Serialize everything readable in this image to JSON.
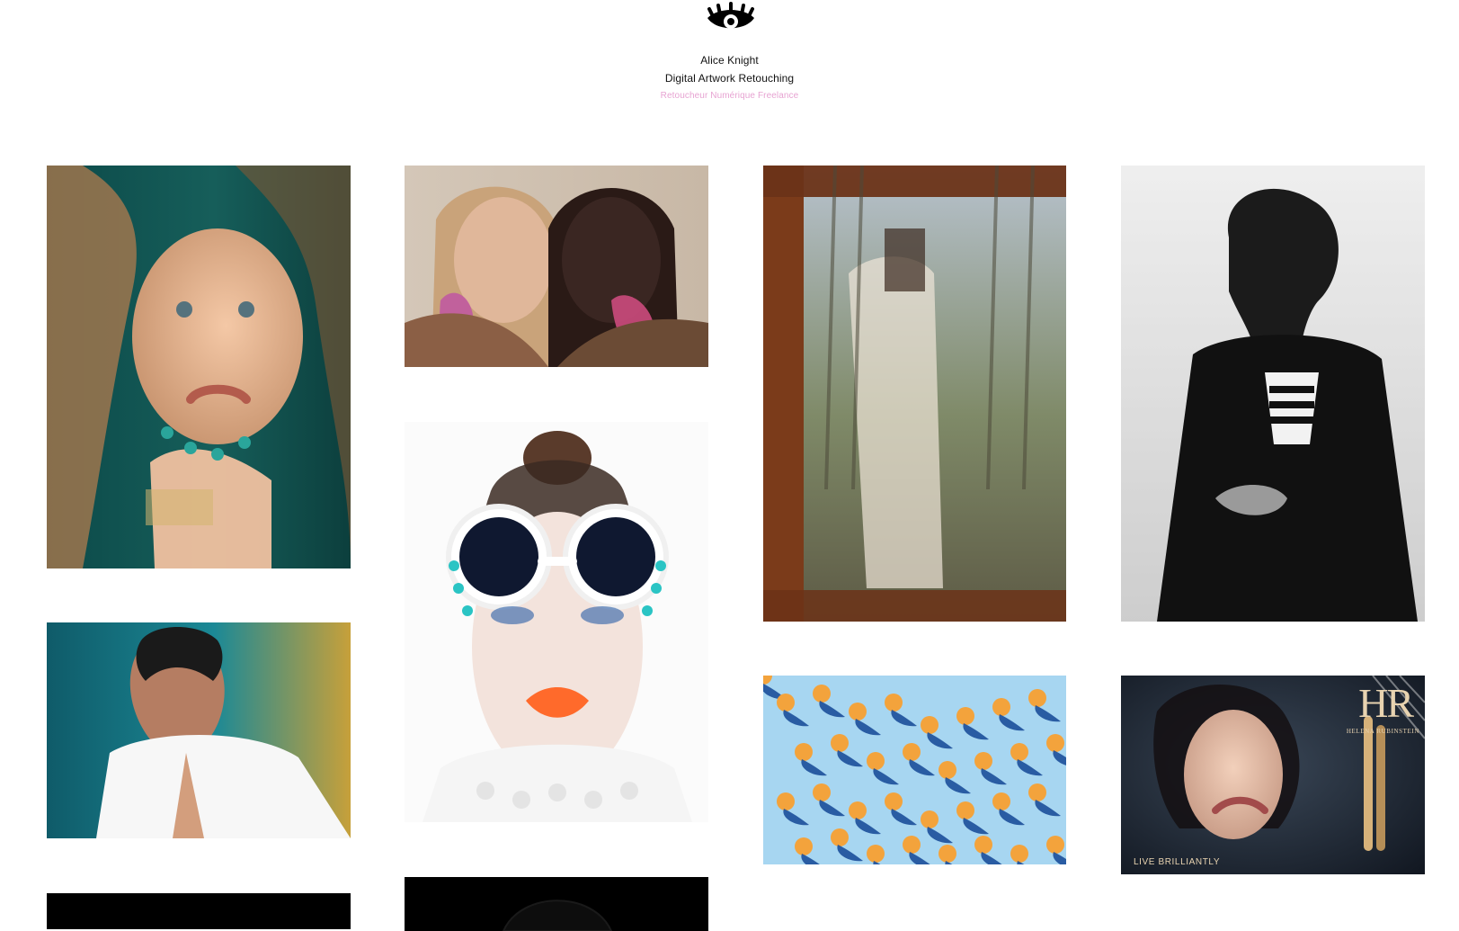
{
  "header": {
    "logo_icon": "eye-lashes-icon",
    "name": "Alice Knight",
    "subtitle": "Digital Artwork Retouching",
    "tagline": "Retoucheur Numérique Freelance",
    "tagline_color": "#e7a3d2"
  },
  "gallery": {
    "items": [
      {
        "id": "t1",
        "alt": "beauty-portrait-teal-nails"
      },
      {
        "id": "t2",
        "alt": "two-models-earrings"
      },
      {
        "id": "t3",
        "alt": "reflection-window-suit"
      },
      {
        "id": "t4",
        "alt": "bw-coat-portrait"
      },
      {
        "id": "t5",
        "alt": "white-suit-golden-backdrop"
      },
      {
        "id": "t6",
        "alt": "white-sunglasses-orange-lips"
      },
      {
        "id": "t7",
        "alt": "pattern-orange-shadows"
      },
      {
        "id": "t8",
        "alt": "helena-rubinstein-ad",
        "brand_mark": "HR",
        "brand_name": "HELENA RUBINSTEIN",
        "footer_text": "LIVE BRILLIANTLY"
      },
      {
        "id": "t9",
        "alt": "dark-image-partial"
      },
      {
        "id": "t10",
        "alt": "dark-image-partial-2"
      }
    ]
  }
}
